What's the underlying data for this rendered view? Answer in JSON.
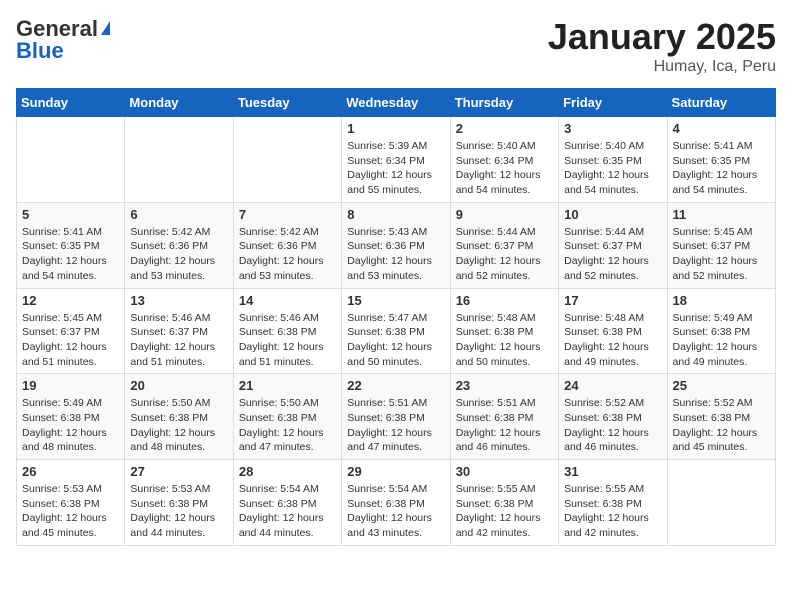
{
  "header": {
    "logo_general": "General",
    "logo_blue": "Blue",
    "month_title": "January 2025",
    "location": "Humay, Ica, Peru"
  },
  "weekdays": [
    "Sunday",
    "Monday",
    "Tuesday",
    "Wednesday",
    "Thursday",
    "Friday",
    "Saturday"
  ],
  "weeks": [
    [
      {
        "day": "",
        "sunrise": "",
        "sunset": "",
        "daylight": ""
      },
      {
        "day": "",
        "sunrise": "",
        "sunset": "",
        "daylight": ""
      },
      {
        "day": "",
        "sunrise": "",
        "sunset": "",
        "daylight": ""
      },
      {
        "day": "1",
        "sunrise": "Sunrise: 5:39 AM",
        "sunset": "Sunset: 6:34 PM",
        "daylight": "Daylight: 12 hours and 55 minutes."
      },
      {
        "day": "2",
        "sunrise": "Sunrise: 5:40 AM",
        "sunset": "Sunset: 6:34 PM",
        "daylight": "Daylight: 12 hours and 54 minutes."
      },
      {
        "day": "3",
        "sunrise": "Sunrise: 5:40 AM",
        "sunset": "Sunset: 6:35 PM",
        "daylight": "Daylight: 12 hours and 54 minutes."
      },
      {
        "day": "4",
        "sunrise": "Sunrise: 5:41 AM",
        "sunset": "Sunset: 6:35 PM",
        "daylight": "Daylight: 12 hours and 54 minutes."
      }
    ],
    [
      {
        "day": "5",
        "sunrise": "Sunrise: 5:41 AM",
        "sunset": "Sunset: 6:35 PM",
        "daylight": "Daylight: 12 hours and 54 minutes."
      },
      {
        "day": "6",
        "sunrise": "Sunrise: 5:42 AM",
        "sunset": "Sunset: 6:36 PM",
        "daylight": "Daylight: 12 hours and 53 minutes."
      },
      {
        "day": "7",
        "sunrise": "Sunrise: 5:42 AM",
        "sunset": "Sunset: 6:36 PM",
        "daylight": "Daylight: 12 hours and 53 minutes."
      },
      {
        "day": "8",
        "sunrise": "Sunrise: 5:43 AM",
        "sunset": "Sunset: 6:36 PM",
        "daylight": "Daylight: 12 hours and 53 minutes."
      },
      {
        "day": "9",
        "sunrise": "Sunrise: 5:44 AM",
        "sunset": "Sunset: 6:37 PM",
        "daylight": "Daylight: 12 hours and 52 minutes."
      },
      {
        "day": "10",
        "sunrise": "Sunrise: 5:44 AM",
        "sunset": "Sunset: 6:37 PM",
        "daylight": "Daylight: 12 hours and 52 minutes."
      },
      {
        "day": "11",
        "sunrise": "Sunrise: 5:45 AM",
        "sunset": "Sunset: 6:37 PM",
        "daylight": "Daylight: 12 hours and 52 minutes."
      }
    ],
    [
      {
        "day": "12",
        "sunrise": "Sunrise: 5:45 AM",
        "sunset": "Sunset: 6:37 PM",
        "daylight": "Daylight: 12 hours and 51 minutes."
      },
      {
        "day": "13",
        "sunrise": "Sunrise: 5:46 AM",
        "sunset": "Sunset: 6:37 PM",
        "daylight": "Daylight: 12 hours and 51 minutes."
      },
      {
        "day": "14",
        "sunrise": "Sunrise: 5:46 AM",
        "sunset": "Sunset: 6:38 PM",
        "daylight": "Daylight: 12 hours and 51 minutes."
      },
      {
        "day": "15",
        "sunrise": "Sunrise: 5:47 AM",
        "sunset": "Sunset: 6:38 PM",
        "daylight": "Daylight: 12 hours and 50 minutes."
      },
      {
        "day": "16",
        "sunrise": "Sunrise: 5:48 AM",
        "sunset": "Sunset: 6:38 PM",
        "daylight": "Daylight: 12 hours and 50 minutes."
      },
      {
        "day": "17",
        "sunrise": "Sunrise: 5:48 AM",
        "sunset": "Sunset: 6:38 PM",
        "daylight": "Daylight: 12 hours and 49 minutes."
      },
      {
        "day": "18",
        "sunrise": "Sunrise: 5:49 AM",
        "sunset": "Sunset: 6:38 PM",
        "daylight": "Daylight: 12 hours and 49 minutes."
      }
    ],
    [
      {
        "day": "19",
        "sunrise": "Sunrise: 5:49 AM",
        "sunset": "Sunset: 6:38 PM",
        "daylight": "Daylight: 12 hours and 48 minutes."
      },
      {
        "day": "20",
        "sunrise": "Sunrise: 5:50 AM",
        "sunset": "Sunset: 6:38 PM",
        "daylight": "Daylight: 12 hours and 48 minutes."
      },
      {
        "day": "21",
        "sunrise": "Sunrise: 5:50 AM",
        "sunset": "Sunset: 6:38 PM",
        "daylight": "Daylight: 12 hours and 47 minutes."
      },
      {
        "day": "22",
        "sunrise": "Sunrise: 5:51 AM",
        "sunset": "Sunset: 6:38 PM",
        "daylight": "Daylight: 12 hours and 47 minutes."
      },
      {
        "day": "23",
        "sunrise": "Sunrise: 5:51 AM",
        "sunset": "Sunset: 6:38 PM",
        "daylight": "Daylight: 12 hours and 46 minutes."
      },
      {
        "day": "24",
        "sunrise": "Sunrise: 5:52 AM",
        "sunset": "Sunset: 6:38 PM",
        "daylight": "Daylight: 12 hours and 46 minutes."
      },
      {
        "day": "25",
        "sunrise": "Sunrise: 5:52 AM",
        "sunset": "Sunset: 6:38 PM",
        "daylight": "Daylight: 12 hours and 45 minutes."
      }
    ],
    [
      {
        "day": "26",
        "sunrise": "Sunrise: 5:53 AM",
        "sunset": "Sunset: 6:38 PM",
        "daylight": "Daylight: 12 hours and 45 minutes."
      },
      {
        "day": "27",
        "sunrise": "Sunrise: 5:53 AM",
        "sunset": "Sunset: 6:38 PM",
        "daylight": "Daylight: 12 hours and 44 minutes."
      },
      {
        "day": "28",
        "sunrise": "Sunrise: 5:54 AM",
        "sunset": "Sunset: 6:38 PM",
        "daylight": "Daylight: 12 hours and 44 minutes."
      },
      {
        "day": "29",
        "sunrise": "Sunrise: 5:54 AM",
        "sunset": "Sunset: 6:38 PM",
        "daylight": "Daylight: 12 hours and 43 minutes."
      },
      {
        "day": "30",
        "sunrise": "Sunrise: 5:55 AM",
        "sunset": "Sunset: 6:38 PM",
        "daylight": "Daylight: 12 hours and 42 minutes."
      },
      {
        "day": "31",
        "sunrise": "Sunrise: 5:55 AM",
        "sunset": "Sunset: 6:38 PM",
        "daylight": "Daylight: 12 hours and 42 minutes."
      },
      {
        "day": "",
        "sunrise": "",
        "sunset": "",
        "daylight": ""
      }
    ]
  ]
}
